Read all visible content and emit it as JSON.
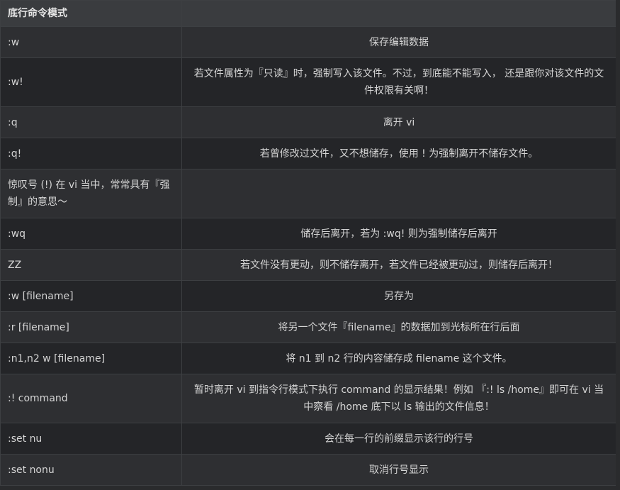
{
  "table": {
    "header": [
      "底行命令模式",
      ""
    ],
    "rows": [
      {
        "cmd": ":w",
        "desc": "保存编辑数据"
      },
      {
        "cmd": ":w!",
        "desc": "若文件属性为『只读』时，强制写入该文件。不过，到底能不能写入， 还是跟你对该文件的文件权限有关啊！"
      },
      {
        "cmd": ":q",
        "desc": "离开 vi"
      },
      {
        "cmd": ":q!",
        "desc": "若曾修改过文件，又不想储存，使用 ! 为强制离开不储存文件。"
      },
      {
        "cmd": "惊叹号 (!) 在 vi 当中，常常具有『强制』的意思～",
        "desc": ""
      },
      {
        "cmd": ":wq",
        "desc": "储存后离开，若为 :wq! 则为强制储存后离开"
      },
      {
        "cmd": "ZZ",
        "desc": "若文件没有更动，则不储存离开，若文件已经被更动过，则储存后离开！"
      },
      {
        "cmd": ":w [filename]",
        "desc": "另存为"
      },
      {
        "cmd": ":r [filename]",
        "desc": "将另一个文件『filename』的数据加到光标所在行后面"
      },
      {
        "cmd": ":n1,n2 w [filename]",
        "desc": "将 n1 到 n2 行的内容储存成 filename 这个文件。"
      },
      {
        "cmd": ":! command",
        "desc": "暂时离开 vi 到指令行模式下执行 command 的显示结果！例如 『:! ls /home』即可在 vi 当中察看 /home 底下以 ls 输出的文件信息！"
      },
      {
        "cmd": ":set nu",
        "desc": "会在每一行的前缀显示该行的行号"
      },
      {
        "cmd": ":set nonu",
        "desc": "取消行号显示"
      }
    ]
  }
}
